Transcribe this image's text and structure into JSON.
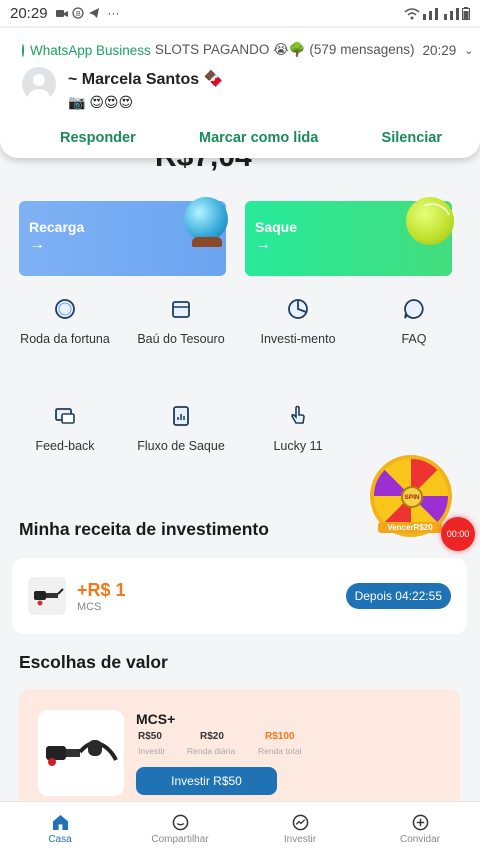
{
  "status_bar": {
    "time": "20:29",
    "more": "···"
  },
  "notification": {
    "app": "WhatsApp Business",
    "group": "SLOTS PAGANDO 😭🌳 (579 mensagens)",
    "time": "20:29",
    "sender": "~ Marcela Santos 🍫",
    "message": "📷 😍😍😍",
    "actions": {
      "reply": "Responder",
      "mark_read": "Marcar como lida",
      "mute": "Silenciar"
    }
  },
  "balance": "R$7,04",
  "cards": {
    "recarga": "Recarga",
    "saque": "Saque",
    "arrow": "→"
  },
  "menu": [
    {
      "label": "Roda da fortuna",
      "icon": "wheel-icon"
    },
    {
      "label": "Baú do Tesouro",
      "icon": "chest-icon"
    },
    {
      "label": "Investi-mento",
      "icon": "pie-chart-icon"
    },
    {
      "label": "FAQ",
      "icon": "chat-bubble-icon"
    },
    {
      "label": "Feed-back",
      "icon": "monitor-icon"
    },
    {
      "label": "Fluxo de Saque",
      "icon": "document-chart-icon"
    },
    {
      "label": "Lucky 11",
      "icon": "hand-pointer-icon"
    }
  ],
  "spin": {
    "center": "SPIN",
    "label": "VencerR$20",
    "timer": "00:00"
  },
  "income_section": {
    "title": "Minha receita de investimento",
    "amount": "+R$ 1",
    "product": "MCS",
    "badge": "Depois 04:22:55"
  },
  "value_section": {
    "title": "Escolhas de valor",
    "product": {
      "name": "MCS+",
      "invest_value": "R$50",
      "invest_label": "Investir",
      "daily_value": "R$20",
      "daily_label": "Renda diária",
      "total_value": "R$100",
      "total_label": "Renda total",
      "button": "Investir R$50"
    }
  },
  "bottom_nav": [
    {
      "label": "Casa",
      "active": true
    },
    {
      "label": "Compartilhar",
      "active": false
    },
    {
      "label": "Investir",
      "active": false
    },
    {
      "label": "Convidar",
      "active": false
    }
  ],
  "colors": {
    "primary": "#1f72b4",
    "whatsapp_green": "#1a8a5a",
    "income": "#f07a1a",
    "total": "#f07a1a"
  }
}
